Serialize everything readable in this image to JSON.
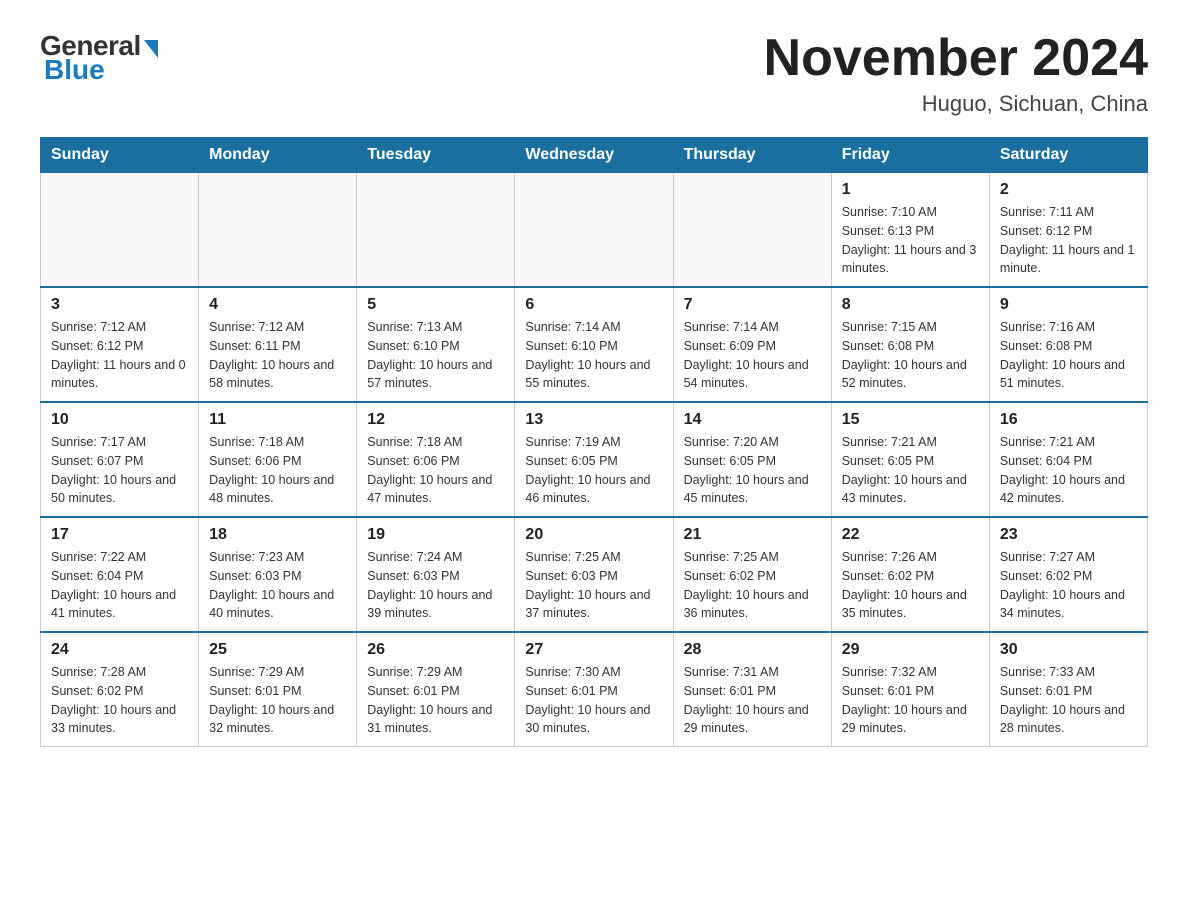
{
  "header": {
    "logo": {
      "general": "General",
      "blue": "Blue"
    },
    "title": "November 2024",
    "location": "Huguo, Sichuan, China"
  },
  "weekdays": [
    "Sunday",
    "Monday",
    "Tuesday",
    "Wednesday",
    "Thursday",
    "Friday",
    "Saturday"
  ],
  "weeks": [
    [
      {
        "day": "",
        "sunrise": "",
        "sunset": "",
        "daylight": ""
      },
      {
        "day": "",
        "sunrise": "",
        "sunset": "",
        "daylight": ""
      },
      {
        "day": "",
        "sunrise": "",
        "sunset": "",
        "daylight": ""
      },
      {
        "day": "",
        "sunrise": "",
        "sunset": "",
        "daylight": ""
      },
      {
        "day": "",
        "sunrise": "",
        "sunset": "",
        "daylight": ""
      },
      {
        "day": "1",
        "sunrise": "Sunrise: 7:10 AM",
        "sunset": "Sunset: 6:13 PM",
        "daylight": "Daylight: 11 hours and 3 minutes."
      },
      {
        "day": "2",
        "sunrise": "Sunrise: 7:11 AM",
        "sunset": "Sunset: 6:12 PM",
        "daylight": "Daylight: 11 hours and 1 minute."
      }
    ],
    [
      {
        "day": "3",
        "sunrise": "Sunrise: 7:12 AM",
        "sunset": "Sunset: 6:12 PM",
        "daylight": "Daylight: 11 hours and 0 minutes."
      },
      {
        "day": "4",
        "sunrise": "Sunrise: 7:12 AM",
        "sunset": "Sunset: 6:11 PM",
        "daylight": "Daylight: 10 hours and 58 minutes."
      },
      {
        "day": "5",
        "sunrise": "Sunrise: 7:13 AM",
        "sunset": "Sunset: 6:10 PM",
        "daylight": "Daylight: 10 hours and 57 minutes."
      },
      {
        "day": "6",
        "sunrise": "Sunrise: 7:14 AM",
        "sunset": "Sunset: 6:10 PM",
        "daylight": "Daylight: 10 hours and 55 minutes."
      },
      {
        "day": "7",
        "sunrise": "Sunrise: 7:14 AM",
        "sunset": "Sunset: 6:09 PM",
        "daylight": "Daylight: 10 hours and 54 minutes."
      },
      {
        "day": "8",
        "sunrise": "Sunrise: 7:15 AM",
        "sunset": "Sunset: 6:08 PM",
        "daylight": "Daylight: 10 hours and 52 minutes."
      },
      {
        "day": "9",
        "sunrise": "Sunrise: 7:16 AM",
        "sunset": "Sunset: 6:08 PM",
        "daylight": "Daylight: 10 hours and 51 minutes."
      }
    ],
    [
      {
        "day": "10",
        "sunrise": "Sunrise: 7:17 AM",
        "sunset": "Sunset: 6:07 PM",
        "daylight": "Daylight: 10 hours and 50 minutes."
      },
      {
        "day": "11",
        "sunrise": "Sunrise: 7:18 AM",
        "sunset": "Sunset: 6:06 PM",
        "daylight": "Daylight: 10 hours and 48 minutes."
      },
      {
        "day": "12",
        "sunrise": "Sunrise: 7:18 AM",
        "sunset": "Sunset: 6:06 PM",
        "daylight": "Daylight: 10 hours and 47 minutes."
      },
      {
        "day": "13",
        "sunrise": "Sunrise: 7:19 AM",
        "sunset": "Sunset: 6:05 PM",
        "daylight": "Daylight: 10 hours and 46 minutes."
      },
      {
        "day": "14",
        "sunrise": "Sunrise: 7:20 AM",
        "sunset": "Sunset: 6:05 PM",
        "daylight": "Daylight: 10 hours and 45 minutes."
      },
      {
        "day": "15",
        "sunrise": "Sunrise: 7:21 AM",
        "sunset": "Sunset: 6:05 PM",
        "daylight": "Daylight: 10 hours and 43 minutes."
      },
      {
        "day": "16",
        "sunrise": "Sunrise: 7:21 AM",
        "sunset": "Sunset: 6:04 PM",
        "daylight": "Daylight: 10 hours and 42 minutes."
      }
    ],
    [
      {
        "day": "17",
        "sunrise": "Sunrise: 7:22 AM",
        "sunset": "Sunset: 6:04 PM",
        "daylight": "Daylight: 10 hours and 41 minutes."
      },
      {
        "day": "18",
        "sunrise": "Sunrise: 7:23 AM",
        "sunset": "Sunset: 6:03 PM",
        "daylight": "Daylight: 10 hours and 40 minutes."
      },
      {
        "day": "19",
        "sunrise": "Sunrise: 7:24 AM",
        "sunset": "Sunset: 6:03 PM",
        "daylight": "Daylight: 10 hours and 39 minutes."
      },
      {
        "day": "20",
        "sunrise": "Sunrise: 7:25 AM",
        "sunset": "Sunset: 6:03 PM",
        "daylight": "Daylight: 10 hours and 37 minutes."
      },
      {
        "day": "21",
        "sunrise": "Sunrise: 7:25 AM",
        "sunset": "Sunset: 6:02 PM",
        "daylight": "Daylight: 10 hours and 36 minutes."
      },
      {
        "day": "22",
        "sunrise": "Sunrise: 7:26 AM",
        "sunset": "Sunset: 6:02 PM",
        "daylight": "Daylight: 10 hours and 35 minutes."
      },
      {
        "day": "23",
        "sunrise": "Sunrise: 7:27 AM",
        "sunset": "Sunset: 6:02 PM",
        "daylight": "Daylight: 10 hours and 34 minutes."
      }
    ],
    [
      {
        "day": "24",
        "sunrise": "Sunrise: 7:28 AM",
        "sunset": "Sunset: 6:02 PM",
        "daylight": "Daylight: 10 hours and 33 minutes."
      },
      {
        "day": "25",
        "sunrise": "Sunrise: 7:29 AM",
        "sunset": "Sunset: 6:01 PM",
        "daylight": "Daylight: 10 hours and 32 minutes."
      },
      {
        "day": "26",
        "sunrise": "Sunrise: 7:29 AM",
        "sunset": "Sunset: 6:01 PM",
        "daylight": "Daylight: 10 hours and 31 minutes."
      },
      {
        "day": "27",
        "sunrise": "Sunrise: 7:30 AM",
        "sunset": "Sunset: 6:01 PM",
        "daylight": "Daylight: 10 hours and 30 minutes."
      },
      {
        "day": "28",
        "sunrise": "Sunrise: 7:31 AM",
        "sunset": "Sunset: 6:01 PM",
        "daylight": "Daylight: 10 hours and 29 minutes."
      },
      {
        "day": "29",
        "sunrise": "Sunrise: 7:32 AM",
        "sunset": "Sunset: 6:01 PM",
        "daylight": "Daylight: 10 hours and 29 minutes."
      },
      {
        "day": "30",
        "sunrise": "Sunrise: 7:33 AM",
        "sunset": "Sunset: 6:01 PM",
        "daylight": "Daylight: 10 hours and 28 minutes."
      }
    ]
  ]
}
